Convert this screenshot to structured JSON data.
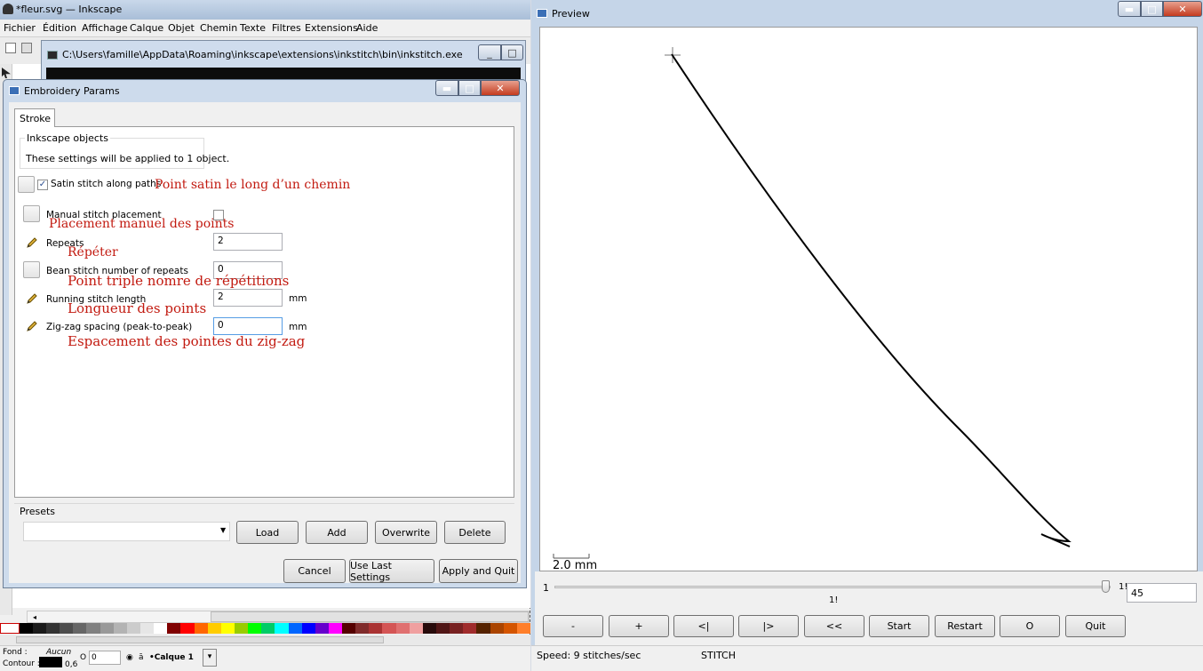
{
  "inkscape": {
    "title": "*fleur.svg — Inkscape",
    "menu": [
      "Fichier",
      "Édition",
      "Affichage",
      "Calque",
      "Objet",
      "Chemin",
      "Texte",
      "Filtres",
      "Extensions",
      "Aide"
    ],
    "status_fill_label": "Fond :",
    "status_fill_value": "Aucun",
    "status_stroke_label": "Contour :",
    "status_stroke_width": "0,6",
    "opacity_label": "O :",
    "opacity_value": "0",
    "layer": "•Calque 1"
  },
  "console": {
    "title": "C:\\Users\\famille\\AppData\\Roaming\\inkscape\\extensions\\inkstitch\\bin\\inkstitch.exe"
  },
  "dialog": {
    "title": "Embroidery Params",
    "tab": "Stroke",
    "group_label": "Inkscape objects",
    "group_text": "These settings will be applied to 1 object.",
    "satin_label": "Satin stitch along paths",
    "satin_checked": true,
    "params": [
      {
        "label": "Manual stitch placement",
        "type": "checkbox",
        "value": "",
        "unit": "",
        "icon": "toggle-box"
      },
      {
        "label": "Repeats",
        "type": "input",
        "value": "2",
        "unit": "",
        "icon": "pencil-icon"
      },
      {
        "label": "Bean stitch number of repeats",
        "type": "input",
        "value": "0",
        "unit": "",
        "icon": "toggle-box"
      },
      {
        "label": "Running stitch length",
        "type": "input",
        "value": "2",
        "unit": "mm",
        "icon": "pencil-icon"
      },
      {
        "label": "Zig-zag spacing (peak-to-peak)",
        "type": "input",
        "value": "0",
        "unit": "mm",
        "icon": "pencil-icon"
      }
    ],
    "annotations": {
      "satin": "Point satin le long d’un chemin",
      "manual": "Placement manuel des points",
      "repeats": "Répéter",
      "bean": "Point triple nomre de répétitions",
      "length": "Longueur des points",
      "zigzag": "Espacement des pointes du zig-zag"
    },
    "presets_label": "Presets",
    "buttons": {
      "load": "Load",
      "add": "Add",
      "overwrite": "Overwrite",
      "delete": "Delete",
      "cancel": "Cancel",
      "use_last": "Use Last Settings",
      "apply_quit": "Apply and Quit"
    }
  },
  "preview": {
    "title": "Preview",
    "scale_label": "2.0 mm",
    "slider_min": "1",
    "slider_max_label": "1!",
    "slider_mid_label": "1!",
    "stitch_value": "45",
    "buttons": [
      "-",
      "+",
      "<|",
      "|>",
      "<<",
      "Start",
      "Restart",
      "O",
      "Quit"
    ],
    "speed": "Speed: 9 stitches/sec",
    "mode": "STITCH"
  },
  "colors": {
    "annotation_red": "#c21a10"
  }
}
